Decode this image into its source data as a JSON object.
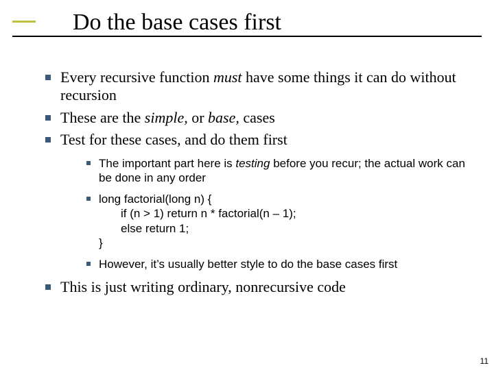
{
  "title": "Do the base cases first",
  "bullets": {
    "b1_pre": "Every recursive function ",
    "b1_em": "must",
    "b1_post": " have some things it can do without recursion",
    "b2_pre": "These are the ",
    "b2_em1": "simple,",
    "b2_mid": " or ",
    "b2_em2": "base,",
    "b2_post": " cases",
    "b3": "Test for these cases, and do them first",
    "b4": "This is just writing ordinary, nonrecursive code"
  },
  "sub": {
    "s1_pre": "The important part here is ",
    "s1_em": "testing",
    "s1_post": " before you recur; the actual work can be done in any order",
    "code_l1": "long factorial(long n) {",
    "code_l2": "if (n > 1) return n * factorial(n – 1);",
    "code_l3": "else return 1;",
    "code_l4": "}",
    "s3": "However, it’s usually better style to do the base cases first"
  },
  "page_number": "11"
}
